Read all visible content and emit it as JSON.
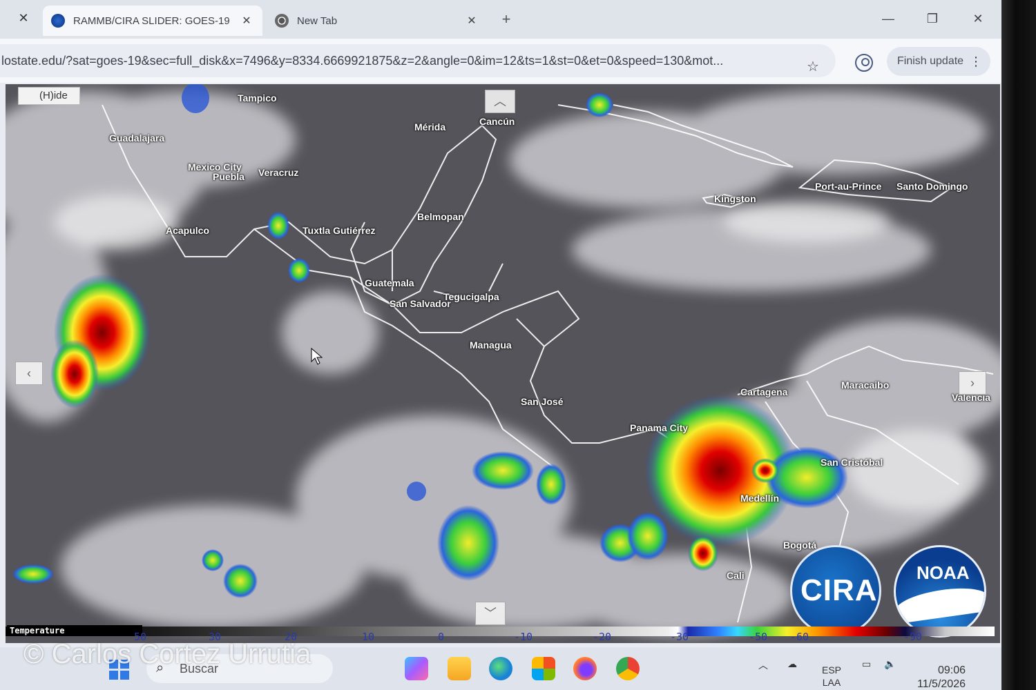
{
  "browser": {
    "tabs": [
      {
        "title": "RAMMB/CIRA SLIDER: GOES-19",
        "active": true
      },
      {
        "title": "New Tab",
        "active": false
      }
    ],
    "url": "lostate.edu/?sat=goes-19&sec=full_disk&x=7496&y=8334.6669921875&z=2&angle=0&im=12&ts=1&st=0&et=0&speed=130&mot...",
    "finish_update": "Finish update"
  },
  "map": {
    "hide_button": "(H)ide",
    "cities": [
      "Tampico",
      "Guadalajara",
      "Mexico City",
      "Puebla",
      "Veracruz",
      "Mérida",
      "Cancún",
      "Acapulco",
      "Tuxtla Gutiérrez",
      "Belmopan",
      "Guatemala",
      "San Salvador",
      "Tegucigalpa",
      "Managua",
      "San José",
      "Panama City",
      "Kingston",
      "Port-au-Prince",
      "Santo Domingo",
      "Cartagena",
      "Maracaibo",
      "Valencia",
      "San Cristóbal",
      "Medellín",
      "Bogotá",
      "Cali"
    ],
    "logos": {
      "cira": "CIRA",
      "noaa": "NOAA"
    }
  },
  "scale": {
    "title": "Temperature",
    "ticks": [
      "50",
      "30",
      "20",
      "10",
      "0",
      "-10",
      "-20",
      "-30",
      "-50",
      "-60",
      "-90"
    ]
  },
  "taskbar": {
    "search_placeholder": "Buscar",
    "language": "ESP",
    "layout": "LAA",
    "time": "09:06",
    "date": "11/5/2026"
  },
  "watermark": "© Carlos Cortez Urrutia",
  "colors": {
    "ir_cold_red": "#d10000",
    "ir_yellow": "#f4ef2a",
    "ir_green": "#36c93a",
    "ir_blue": "#2459d8",
    "coastline": "#ffffff",
    "browser_chrome": "#dfe3ea"
  },
  "icons": [
    "close-icon",
    "plus-icon",
    "minimize-icon",
    "restore-icon",
    "star-icon",
    "profile-icon",
    "more-icon",
    "chevron-up-icon",
    "chevron-down-icon",
    "chevron-left-icon",
    "chevron-right-icon",
    "search-icon",
    "windows-start-icon"
  ]
}
